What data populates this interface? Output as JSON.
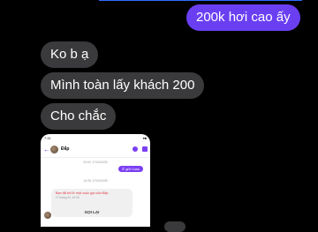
{
  "messages": [
    {
      "direction": "outgoing",
      "text": "200k hơi cao ấy"
    },
    {
      "direction": "incoming",
      "text": "Ko b ạ"
    },
    {
      "direction": "incoming",
      "text": "Mình toàn lấy khách 200"
    },
    {
      "direction": "incoming",
      "text": "Cho chắc"
    }
  ],
  "attachment": {
    "status_time": "7:41",
    "status_right": "▾■",
    "contact_name": "Đắp",
    "time_1": "20:00 17/04/2025",
    "small_out": "Ê gửi t bao",
    "time_2": "10:26 17/04/2025",
    "card_title": "Bạn đã bỏ lỡ một cuộc gọi của Đắp",
    "card_sub": "17 tháng 04, 10:26",
    "card_button": "GỌI LẠI"
  },
  "colors": {
    "background": "#000000",
    "outgoing_bubble": "#6a3ff1",
    "incoming_bubble": "#3a3a3c",
    "accent": "#7b3ff2"
  }
}
